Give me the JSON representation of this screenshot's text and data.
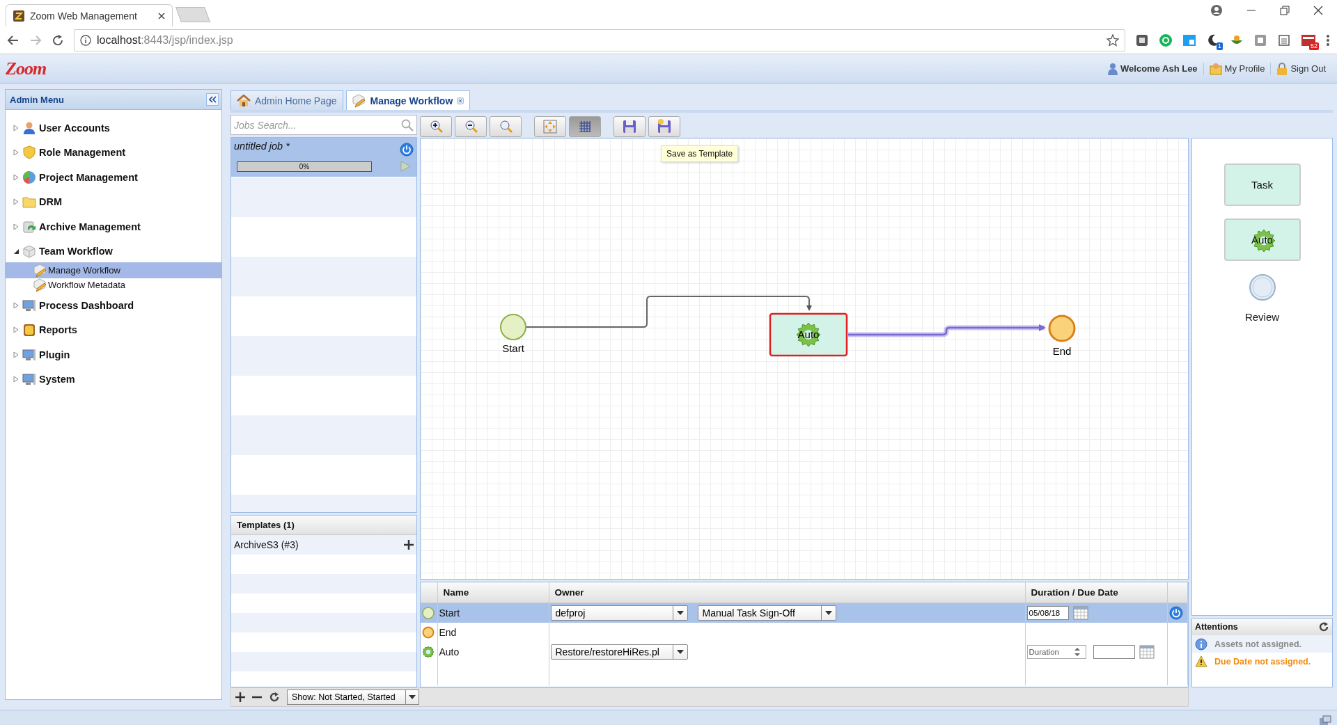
{
  "browser": {
    "tab_title": "Zoom Web Management",
    "url_host": "localhost",
    "url_path": ":8443/jsp/index.jsp",
    "extension_badges": [
      "1",
      "52"
    ]
  },
  "header": {
    "logo": "Zoom",
    "welcome": "Welcome Ash Lee",
    "links": [
      "My Profile",
      "Sign Out"
    ]
  },
  "sidebar": {
    "title": "Admin Menu",
    "items": [
      {
        "label": "User Accounts",
        "expanded": false
      },
      {
        "label": "Role Management",
        "expanded": false
      },
      {
        "label": "Project Management",
        "expanded": false
      },
      {
        "label": "DRM",
        "expanded": false
      },
      {
        "label": "Archive Management",
        "expanded": false
      },
      {
        "label": "Team Workflow",
        "expanded": true,
        "children": [
          {
            "label": "Manage Workflow",
            "selected": true
          },
          {
            "label": "Workflow Metadata",
            "selected": false
          }
        ]
      },
      {
        "label": "Process Dashboard",
        "expanded": false
      },
      {
        "label": "Reports",
        "expanded": false
      },
      {
        "label": "Plugin",
        "expanded": false
      },
      {
        "label": "System",
        "expanded": false
      }
    ]
  },
  "tabs": [
    {
      "label": "Admin Home Page",
      "selected": false,
      "closable": false
    },
    {
      "label": "Manage Workflow",
      "selected": true,
      "closable": true
    }
  ],
  "jobs": {
    "placeholder": "Jobs Search...",
    "items": [
      {
        "name": "untitled job *",
        "selected": true,
        "level": 0,
        "progress": "0%"
      }
    ]
  },
  "templates": {
    "title": "Templates (1)",
    "items": [
      "ArchiveS3 (#3)"
    ]
  },
  "jobs_footer": {
    "filter": "Show: Not Started, Started"
  },
  "toolbar": {
    "buttons": [
      {
        "kind": "zoom_in",
        "pressed": false
      },
      {
        "kind": "zoom_out",
        "pressed": false
      },
      {
        "kind": "zoom_reset",
        "pressed": false
      },
      {
        "kind": "fit",
        "pressed": false
      },
      {
        "kind": "grid",
        "pressed": true
      },
      {
        "kind": "save",
        "pressed": false
      },
      {
        "kind": "save_template",
        "pressed": false
      }
    ],
    "tooltip": "Save as Template"
  },
  "canvas": {
    "nodes": [
      {
        "kind": "start",
        "label": "Start",
        "selected": false
      },
      {
        "kind": "auto",
        "label": "Auto",
        "selected": true
      },
      {
        "kind": "end",
        "label": "End",
        "selected": false
      }
    ],
    "edges": [
      {
        "highlighted": false
      },
      {
        "highlighted": true
      }
    ]
  },
  "palette": [
    {
      "kind": "task",
      "label": "Task"
    },
    {
      "kind": "auto",
      "label": "Auto"
    },
    {
      "kind": "review",
      "label": "Review"
    }
  ],
  "table": {
    "columns": [
      "Name",
      "Owner",
      "Duration / Due Date"
    ],
    "rows": [
      {
        "kind": "start",
        "name": "Start",
        "selected": true,
        "owner": "defproj",
        "action": "Manual Task Sign-Off",
        "date": "05/08/18"
      },
      {
        "kind": "end",
        "name": "End",
        "selected": false
      },
      {
        "kind": "auto",
        "name": "Auto",
        "selected": false,
        "owner": "Restore/restoreHiRes.pl",
        "duration_placeholder": "Duration"
      }
    ]
  },
  "attentions": {
    "title": "Attentions",
    "items": [
      {
        "kind": "info",
        "text": "Assets not assigned."
      },
      {
        "kind": "warning",
        "text": "Due Date not assigned."
      }
    ]
  }
}
